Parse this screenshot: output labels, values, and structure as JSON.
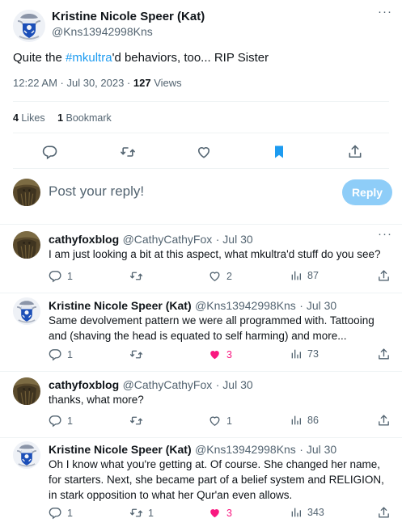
{
  "main_tweet": {
    "author_name": "Kristine Nicole Speer (Kat)",
    "author_handle": "@Kns13942998Kns",
    "text_prefix": "Quite the ",
    "hashtag": "#mkultra",
    "text_suffix": "'d behaviors, too... RIP Sister",
    "time": "12:22 AM · Jul 30, 2023 · ",
    "views_count": "127",
    "views_label": " Views",
    "likes_count": "4",
    "likes_label": " Likes",
    "bookmarks_count": "1",
    "bookmarks_label": " Bookmark"
  },
  "composer": {
    "placeholder": "Post your reply!",
    "button_label": "Reply"
  },
  "replies": [
    {
      "name": "cathyfoxblog",
      "handle": "@CathyCathyFox",
      "date": "· Jul 30",
      "text": "I am just looking a bit at this aspect, what mkultra'd stuff do you see?",
      "replies": "1",
      "reposts": "",
      "likes": "2",
      "views": "87",
      "liked": false
    },
    {
      "name": "Kristine Nicole Speer (Kat)",
      "handle": "@Kns13942998Kns",
      "date": "· Jul 30",
      "text": "Same devolvement pattern we were all programmed with. Tattooing and (shaving the head is equated to self harming) and more...",
      "replies": "1",
      "reposts": "",
      "likes": "3",
      "views": "73",
      "liked": true
    },
    {
      "name": "cathyfoxblog",
      "handle": "@CathyCathyFox",
      "date": "· Jul 30",
      "text": "thanks, what more?",
      "replies": "1",
      "reposts": "",
      "likes": "1",
      "views": "86",
      "liked": false
    },
    {
      "name": "Kristine Nicole Speer (Kat)",
      "handle": "@Kns13942998Kns",
      "date": "· Jul 30",
      "text": "Oh I know what you're getting at. Of course. She changed her name, for starters. Next, she became part of a belief system and RELIGION, in stark opposition to what her Qur'an even allows.",
      "replies": "1",
      "reposts": "1",
      "likes": "3",
      "views": "343",
      "liked": true
    }
  ],
  "colors": {
    "accent": "#1d9bf0",
    "like_active": "#f91880",
    "reply_button": "#8ecdf8",
    "muted": "#536471"
  },
  "icons": [
    "crest-avatar",
    "brown-avatar",
    "reply-icon",
    "repost-icon",
    "heart-icon",
    "bookmark-icon",
    "share-icon",
    "views-icon",
    "more-icon"
  ]
}
